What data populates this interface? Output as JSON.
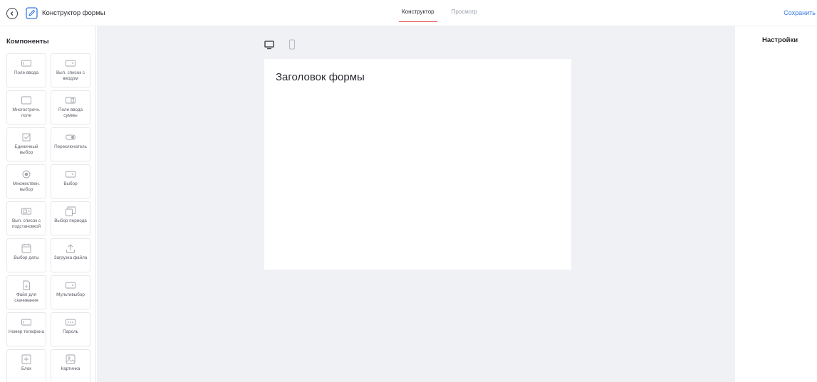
{
  "header": {
    "title": "Конструктор формы",
    "tabs": [
      {
        "label": "Конструктор",
        "active": true
      },
      {
        "label": "Просмотр",
        "active": false
      }
    ],
    "save_label": "Сохранить"
  },
  "sidebar": {
    "title": "Компоненты",
    "items": [
      {
        "label": "Поле ввода",
        "icon": "input-field-icon"
      },
      {
        "label": "Вып. список с вводом",
        "icon": "dropdown-input-icon"
      },
      {
        "label": "Многострочн. поле",
        "icon": "textarea-icon"
      },
      {
        "label": "Поле ввода суммы",
        "icon": "amount-input-icon"
      },
      {
        "label": "Единичный выбор",
        "icon": "checkbox-icon"
      },
      {
        "label": "Переключатель",
        "icon": "toggle-icon"
      },
      {
        "label": "Множествен. выбор",
        "icon": "radio-icon"
      },
      {
        "label": "Выбор",
        "icon": "select-icon"
      },
      {
        "label": "Вып. список с подстановкой",
        "icon": "dropdown-substitution-icon"
      },
      {
        "label": "Выбор периода",
        "icon": "period-icon"
      },
      {
        "label": "Выбор даты",
        "icon": "calendar-icon"
      },
      {
        "label": "Загрузка файла",
        "icon": "upload-icon"
      },
      {
        "label": "Файл для скачивания",
        "icon": "file-download-icon"
      },
      {
        "label": "Мультивыбор",
        "icon": "multiselect-icon"
      },
      {
        "label": "Номер телефона",
        "icon": "phone-field-icon"
      },
      {
        "label": "Пароль",
        "icon": "password-icon"
      },
      {
        "label": "Блок",
        "icon": "block-icon"
      },
      {
        "label": "Картинка",
        "icon": "image-icon"
      }
    ]
  },
  "canvas": {
    "form_title": "Заголовок формы"
  },
  "settings": {
    "title": "Настройки"
  },
  "colors": {
    "accent": "#3a78e6",
    "tab_underline": "#e65656",
    "canvas_bg": "#f0f1f5"
  }
}
